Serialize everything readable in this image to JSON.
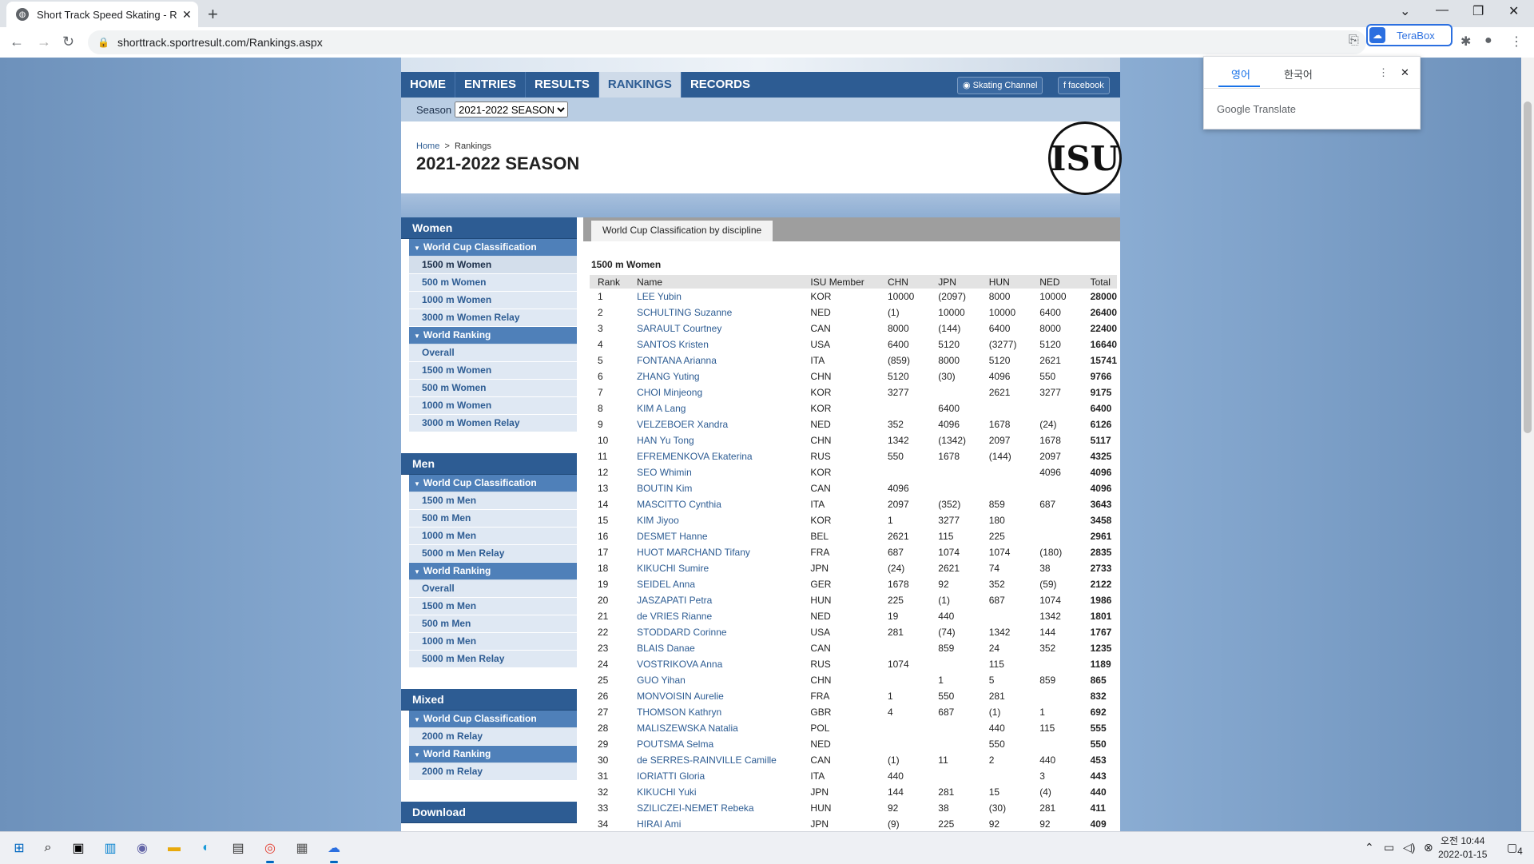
{
  "browser": {
    "tab_title": "Short Track Speed Skating - Ra",
    "url": "shorttrack.sportresult.com/Rankings.aspx",
    "terabox_label": "TeraBox"
  },
  "translate_popup": {
    "tab_source": "영어",
    "tab_target": "한국어",
    "brand_google": "Google",
    "brand_translate": "Translate"
  },
  "nav": {
    "items": [
      {
        "label": "HOME"
      },
      {
        "label": "ENTRIES"
      },
      {
        "label": "RESULTS"
      },
      {
        "label": "RANKINGS"
      },
      {
        "label": "RECORDS"
      }
    ],
    "skating_channel": "Skating Channel",
    "facebook": "facebook"
  },
  "season": {
    "label": "Season",
    "selected": "2021-2022 SEASON"
  },
  "header": {
    "breadcrumb_home": "Home",
    "breadcrumb_sep": ">",
    "breadcrumb_current": "Rankings",
    "title": "2021-2022 SEASON",
    "logo_text": "ISU"
  },
  "sidebar": {
    "women": {
      "title": "Women",
      "wc_label": "World Cup Classification",
      "wc_items": [
        "1500 m Women",
        "500 m Women",
        "1000 m Women",
        "3000 m Women Relay"
      ],
      "wr_label": "World Ranking",
      "wr_items": [
        "Overall",
        "1500 m Women",
        "500 m Women",
        "1000 m Women",
        "3000 m Women Relay"
      ]
    },
    "men": {
      "title": "Men",
      "wc_label": "World Cup Classification",
      "wc_items": [
        "1500 m Men",
        "500 m Men",
        "1000 m Men",
        "5000 m Men Relay"
      ],
      "wr_label": "World Ranking",
      "wr_items": [
        "Overall",
        "1500 m Men",
        "500 m Men",
        "1000 m Men",
        "5000 m Men Relay"
      ]
    },
    "mixed": {
      "title": "Mixed",
      "wc_label": "World Cup Classification",
      "wc_items": [
        "2000 m Relay"
      ],
      "wr_label": "World Ranking",
      "wr_items": [
        "2000 m Relay"
      ]
    },
    "download": {
      "title": "Download"
    }
  },
  "content": {
    "tab_label": "World Cup Classification by discipline",
    "title": "1500 m Women",
    "columns": [
      "Rank",
      "Name",
      "ISU Member",
      "CHN",
      "JPN",
      "HUN",
      "NED",
      "Total"
    ],
    "rows": [
      [
        "1",
        "LEE Yubin",
        "KOR",
        "10000",
        "(2097)",
        "8000",
        "10000",
        "28000"
      ],
      [
        "2",
        "SCHULTING Suzanne",
        "NED",
        "(1)",
        "10000",
        "10000",
        "6400",
        "26400"
      ],
      [
        "3",
        "SARAULT Courtney",
        "CAN",
        "8000",
        "(144)",
        "6400",
        "8000",
        "22400"
      ],
      [
        "4",
        "SANTOS Kristen",
        "USA",
        "6400",
        "5120",
        "(3277)",
        "5120",
        "16640"
      ],
      [
        "5",
        "FONTANA Arianna",
        "ITA",
        "(859)",
        "8000",
        "5120",
        "2621",
        "15741"
      ],
      [
        "6",
        "ZHANG Yuting",
        "CHN",
        "5120",
        "(30)",
        "4096",
        "550",
        "9766"
      ],
      [
        "7",
        "CHOI Minjeong",
        "KOR",
        "3277",
        "",
        "2621",
        "3277",
        "9175"
      ],
      [
        "8",
        "KIM A Lang",
        "KOR",
        "",
        "6400",
        "",
        "",
        "6400"
      ],
      [
        "9",
        "VELZEBOER Xandra",
        "NED",
        "352",
        "4096",
        "1678",
        "(24)",
        "6126"
      ],
      [
        "10",
        "HAN Yu Tong",
        "CHN",
        "1342",
        "(1342)",
        "2097",
        "1678",
        "5117"
      ],
      [
        "11",
        "EFREMENKOVA Ekaterina",
        "RUS",
        "550",
        "1678",
        "(144)",
        "2097",
        "4325"
      ],
      [
        "12",
        "SEO Whimin",
        "KOR",
        "",
        "",
        "",
        "4096",
        "4096"
      ],
      [
        "13",
        "BOUTIN Kim",
        "CAN",
        "4096",
        "",
        "",
        "",
        "4096"
      ],
      [
        "14",
        "MASCITTO Cynthia",
        "ITA",
        "2097",
        "(352)",
        "859",
        "687",
        "3643"
      ],
      [
        "15",
        "KIM Jiyoo",
        "KOR",
        "1",
        "3277",
        "180",
        "",
        "3458"
      ],
      [
        "16",
        "DESMET Hanne",
        "BEL",
        "2621",
        "115",
        "225",
        "",
        "2961"
      ],
      [
        "17",
        "HUOT MARCHAND Tifany",
        "FRA",
        "687",
        "1074",
        "1074",
        "(180)",
        "2835"
      ],
      [
        "18",
        "KIKUCHI Sumire",
        "JPN",
        "(24)",
        "2621",
        "74",
        "38",
        "2733"
      ],
      [
        "19",
        "SEIDEL Anna",
        "GER",
        "1678",
        "92",
        "352",
        "(59)",
        "2122"
      ],
      [
        "20",
        "JASZAPATI Petra",
        "HUN",
        "225",
        "(1)",
        "687",
        "1074",
        "1986"
      ],
      [
        "21",
        "de VRIES Rianne",
        "NED",
        "19",
        "440",
        "",
        "1342",
        "1801"
      ],
      [
        "22",
        "STODDARD Corinne",
        "USA",
        "281",
        "(74)",
        "1342",
        "144",
        "1767"
      ],
      [
        "23",
        "BLAIS Danae",
        "CAN",
        "",
        "859",
        "24",
        "352",
        "1235"
      ],
      [
        "24",
        "VOSTRIKOVA Anna",
        "RUS",
        "1074",
        "",
        "115",
        "",
        "1189"
      ],
      [
        "25",
        "GUO Yihan",
        "CHN",
        "",
        "1",
        "5",
        "859",
        "865"
      ],
      [
        "26",
        "MONVOISIN Aurelie",
        "FRA",
        "1",
        "550",
        "281",
        "",
        "832"
      ],
      [
        "27",
        "THOMSON Kathryn",
        "GBR",
        "4",
        "687",
        "(1)",
        "1",
        "692"
      ],
      [
        "28",
        "MALISZEWSKA Natalia",
        "POL",
        "",
        "",
        "440",
        "115",
        "555"
      ],
      [
        "29",
        "POUTSMA Selma",
        "NED",
        "",
        "",
        "550",
        "",
        "550"
      ],
      [
        "30",
        "de SERRES-RAINVILLE Camille",
        "CAN",
        "(1)",
        "11",
        "2",
        "440",
        "453"
      ],
      [
        "31",
        "IORIATTI Gloria",
        "ITA",
        "440",
        "",
        "",
        "3",
        "443"
      ],
      [
        "32",
        "KIKUCHI Yuki",
        "JPN",
        "144",
        "281",
        "15",
        "(4)",
        "440"
      ],
      [
        "33",
        "SZILICZEI-NEMET Rebeka",
        "HUN",
        "92",
        "38",
        "(30)",
        "281",
        "411"
      ],
      [
        "34",
        "HIRAI Ami",
        "JPN",
        "(9)",
        "225",
        "92",
        "92",
        "409"
      ]
    ]
  },
  "taskbar": {
    "clock_time": "오전 10:44",
    "clock_date": "2022-01-15",
    "notification_count": "4"
  }
}
